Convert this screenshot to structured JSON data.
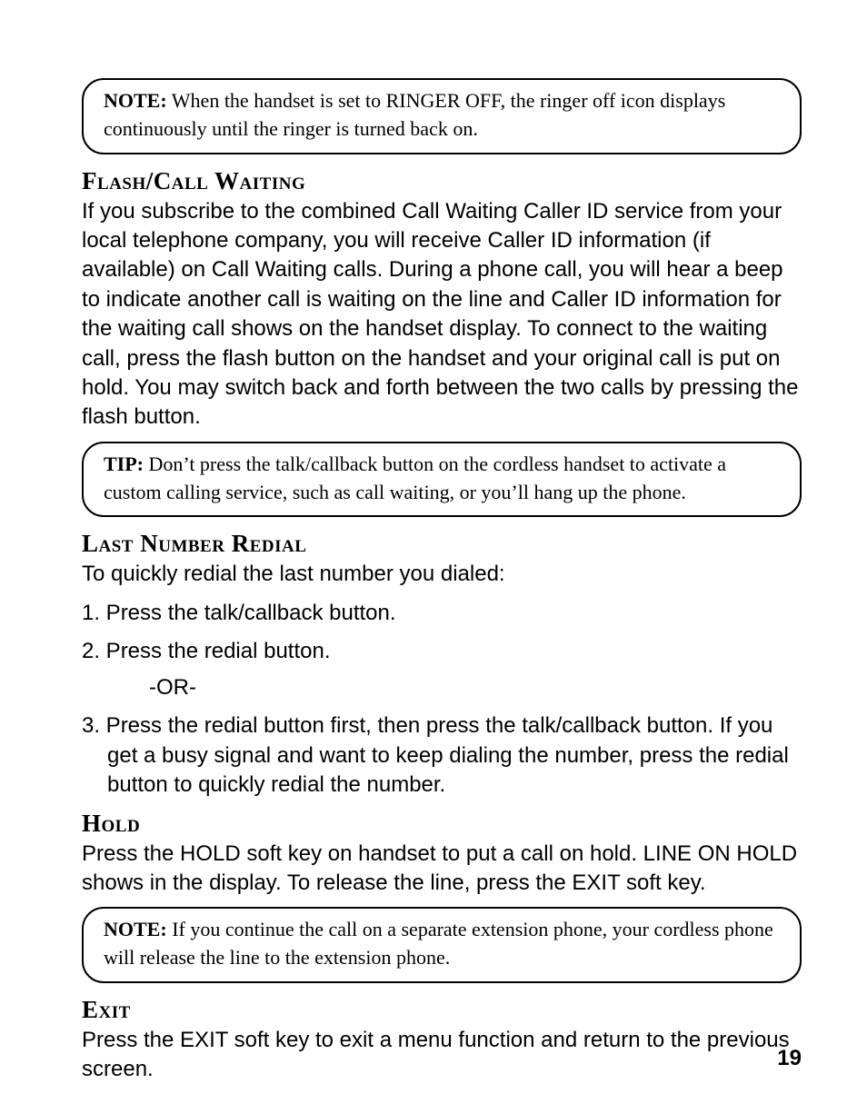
{
  "note1": {
    "lead": "NOTE:",
    "text": " When the handset is set to RINGER OFF, the ringer off icon displays continuously until the ringer is turned back on."
  },
  "flash": {
    "head": "Flash/Call Waiting",
    "body": "If you subscribe to the combined Call Waiting Caller ID service from your local telephone company, you will receive Caller ID information (if available) on Call Waiting calls. During a phone call, you will hear a beep to indicate another call is waiting on the line and Caller ID information for the waiting call  shows on the handset display. To connect to the waiting call, press the flash button on the handset and your original call is put on hold. You may switch back and forth between the two calls by pressing the flash button."
  },
  "tip1": {
    "lead": "TIP:",
    "text": " Don’t press the talk/callback button on the cordless handset to activate a custom calling service, such as call waiting, or you’ll hang up the phone."
  },
  "redial": {
    "head": "Last Number Redial",
    "intro": "To quickly redial the last number you dialed:",
    "step1": "1. Press the talk/callback button.",
    "step2": "2. Press the redial button.",
    "or": "-OR-",
    "step3": "3. Press the redial button first, then press the talk/callback button. If you get a busy signal and want to keep dialing the number, press the redial button to quickly redial the number."
  },
  "hold": {
    "head": "Hold",
    "body": "Press the HOLD soft key on handset to put a call on hold. LINE ON HOLD shows in the display. To release the line, press the EXIT soft key."
  },
  "note2": {
    "lead": "NOTE:",
    "text": " If you continue the call on a separate extension phone, your cordless phone will release the line to the extension phone."
  },
  "exit": {
    "head": "Exit",
    "body": "Press the EXIT soft key to exit a menu function and return to the previous screen."
  },
  "pagenum": "19"
}
